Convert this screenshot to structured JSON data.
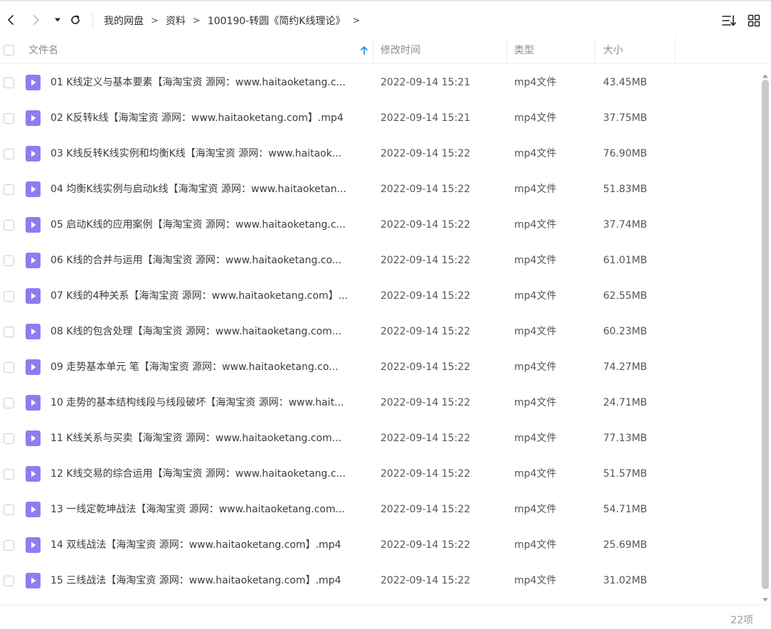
{
  "toolbar": {
    "breadcrumb": [
      "我的网盘",
      "资料",
      "100190-转圆《简约K线理论》"
    ],
    "breadcrumb_sep": ">"
  },
  "columns": {
    "name": "文件名",
    "modified": "修改时间",
    "type": "类型",
    "size": "大小"
  },
  "files": [
    {
      "name": "01 K线定义与基本要素【海淘宝资 源网：www.haitaoketang.c...",
      "modified": "2022-09-14 15:21",
      "type": "mp4文件",
      "size": "43.45MB"
    },
    {
      "name": "02 K反转k线【海淘宝资 源网：www.haitaoketang.com】.mp4",
      "modified": "2022-09-14 15:21",
      "type": "mp4文件",
      "size": "37.75MB"
    },
    {
      "name": "03 K线反转K线实例和均衡K线【海淘宝资 源网：www.haitaok...",
      "modified": "2022-09-14 15:22",
      "type": "mp4文件",
      "size": "76.90MB"
    },
    {
      "name": "04 均衡K线实例与启动k线【海淘宝资 源网：www.haitaoketan...",
      "modified": "2022-09-14 15:22",
      "type": "mp4文件",
      "size": "51.83MB"
    },
    {
      "name": "05 启动K线的应用案例【海淘宝资 源网：www.haitaoketang.c...",
      "modified": "2022-09-14 15:22",
      "type": "mp4文件",
      "size": "37.74MB"
    },
    {
      "name": "06 K线的合并与运用【海淘宝资 源网：www.haitaoketang.co...",
      "modified": "2022-09-14 15:22",
      "type": "mp4文件",
      "size": "61.01MB"
    },
    {
      "name": "07 K线的4种关系【海淘宝资 源网：www.haitaoketang.com】...",
      "modified": "2022-09-14 15:22",
      "type": "mp4文件",
      "size": "62.55MB"
    },
    {
      "name": "08 K线的包含处理【海淘宝资 源网：www.haitaoketang.com...",
      "modified": "2022-09-14 15:22",
      "type": "mp4文件",
      "size": "60.23MB"
    },
    {
      "name": "09 走势基本单元 笔【海淘宝资 源网：www.haitaoketang.co...",
      "modified": "2022-09-14 15:22",
      "type": "mp4文件",
      "size": "74.27MB"
    },
    {
      "name": "10 走势的基本结构线段与线段破坏【海淘宝资 源网：www.hait...",
      "modified": "2022-09-14 15:22",
      "type": "mp4文件",
      "size": "24.71MB"
    },
    {
      "name": "11 K线关系与买卖【海淘宝资 源网：www.haitaoketang.com...",
      "modified": "2022-09-14 15:22",
      "type": "mp4文件",
      "size": "77.13MB"
    },
    {
      "name": "12 K线交易的综合运用【海淘宝资 源网：www.haitaoketang.c...",
      "modified": "2022-09-14 15:22",
      "type": "mp4文件",
      "size": "51.57MB"
    },
    {
      "name": "13 一线定乾坤战法【海淘宝资 源网：www.haitaoketang.com...",
      "modified": "2022-09-14 15:22",
      "type": "mp4文件",
      "size": "54.71MB"
    },
    {
      "name": "14 双线战法【海淘宝资 源网：www.haitaoketang.com】.mp4",
      "modified": "2022-09-14 15:22",
      "type": "mp4文件",
      "size": "25.69MB"
    },
    {
      "name": "15 三线战法【海淘宝资 源网：www.haitaoketang.com】.mp4",
      "modified": "2022-09-14 15:22",
      "type": "mp4文件",
      "size": "31.02MB"
    }
  ],
  "footer": {
    "count": "22项"
  },
  "colors": {
    "accent": "#2f8cf0",
    "video_icon": "#8f7cf2"
  },
  "icons": {
    "back": "back-arrow-icon",
    "forward": "forward-arrow-icon",
    "dropdown": "caret-down-icon",
    "refresh": "refresh-icon",
    "sort": "sort-list-icon",
    "grid": "grid-view-icon",
    "file": "video-file-icon"
  }
}
